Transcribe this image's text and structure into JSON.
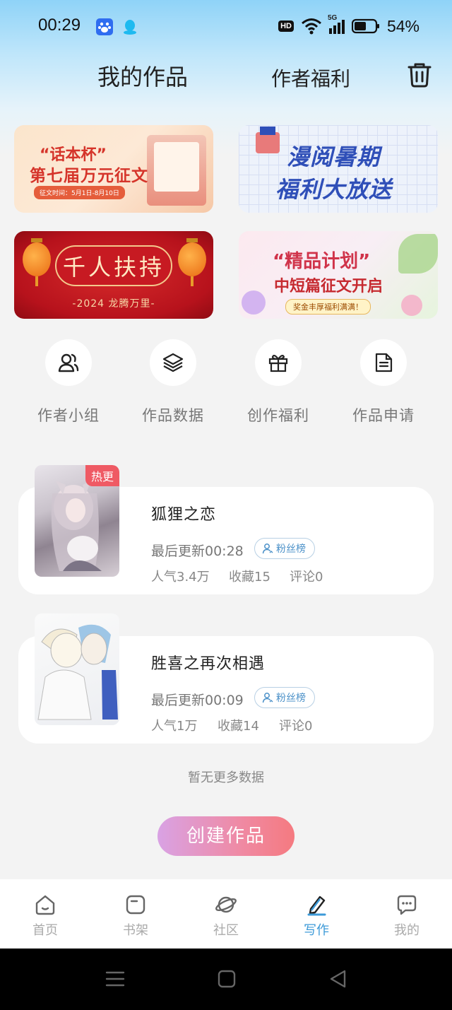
{
  "status_bar": {
    "time": "00:29",
    "network": "HD",
    "signal": "5G",
    "battery": "54%"
  },
  "header": {
    "title": "我的作品",
    "benefits": "作者福利"
  },
  "banners": [
    {
      "line1": "“话本杯”",
      "line2": "第七届万元征文",
      "date": "征文时间：5月1日-8月10日"
    },
    {
      "line1": "漫阅暑期",
      "line2": "福利大放送"
    },
    {
      "title": "千人扶持",
      "sub": "-2024 龙腾万里-"
    },
    {
      "title": "“精品计划”",
      "sub": "中短篇征文开启",
      "badge": "奖金丰厚福利满满！"
    }
  ],
  "quick_actions": [
    {
      "label": "作者小组",
      "icon": "author-group-icon"
    },
    {
      "label": "作品数据",
      "icon": "layers-icon"
    },
    {
      "label": "创作福利",
      "icon": "gift-icon"
    },
    {
      "label": "作品申请",
      "icon": "document-icon"
    }
  ],
  "works": [
    {
      "title": "狐狸之恋",
      "tag": "热更",
      "update": "最后更新00:28",
      "fan_label": "粉丝榜",
      "popularity": "人气3.4万",
      "favorites": "收藏15",
      "comments": "评论0"
    },
    {
      "title": "胜喜之再次相遇",
      "update": "最后更新00:09",
      "fan_label": "粉丝榜",
      "popularity": "人气1万",
      "favorites": "收藏14",
      "comments": "评论0"
    }
  ],
  "no_more": "暂无更多数据",
  "create_button": "创建作品",
  "tabs": [
    {
      "label": "首页",
      "icon": "home-icon"
    },
    {
      "label": "书架",
      "icon": "bookshelf-icon"
    },
    {
      "label": "社区",
      "icon": "planet-icon"
    },
    {
      "label": "写作",
      "icon": "pen-icon",
      "active": true
    },
    {
      "label": "我的",
      "icon": "chat-icon"
    }
  ],
  "colors": {
    "accent_blue": "#3c9ad8",
    "hot_tag": "#ef5a64",
    "create_gradient_start": "#d9a2e4",
    "create_gradient_end": "#f57a80"
  }
}
